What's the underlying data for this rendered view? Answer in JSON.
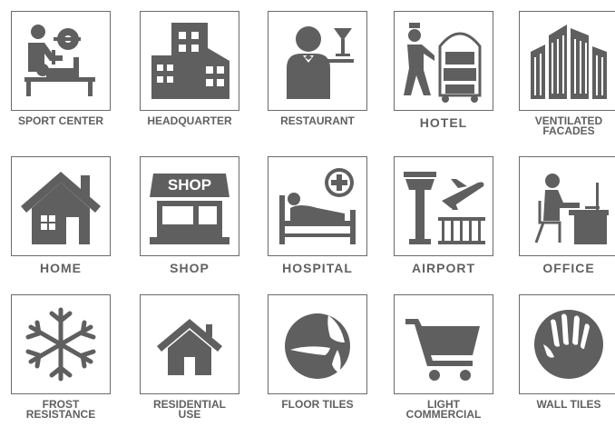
{
  "icons": [
    {
      "label": "SPORT CENTER",
      "icon": "weightlifting-icon"
    },
    {
      "label": "HEADQUARTER",
      "icon": "buildings-icon"
    },
    {
      "label": "RESTAURANT",
      "icon": "waiter-icon"
    },
    {
      "label": "HOTEL",
      "icon": "bellhop-luggage-cart-icon"
    },
    {
      "label": "VENTILATED\nFACADES",
      "icon": "skyscrapers-icon"
    },
    {
      "label": "HOME",
      "icon": "house-icon"
    },
    {
      "label": "SHOP",
      "icon": "shop-icon",
      "sign_text": "SHOP"
    },
    {
      "label": "HOSPITAL",
      "icon": "hospital-bed-icon"
    },
    {
      "label": "AIRPORT",
      "icon": "airport-tower-icon"
    },
    {
      "label": "OFFICE",
      "icon": "office-desk-icon"
    },
    {
      "label": "FROST\nRESISTANCE",
      "icon": "snowflake-icon"
    },
    {
      "label": "RESIDENTIAL\nUSE",
      "icon": "small-house-icon"
    },
    {
      "label": "FLOOR TILES",
      "icon": "floor-tiles-icon"
    },
    {
      "label": "LIGHT\nCOMMERCIAL",
      "icon": "shopping-cart-icon"
    },
    {
      "label": "WALL TILES",
      "icon": "hand-icon"
    }
  ],
  "colors": {
    "icon": "#5f5f5f",
    "label": "#606060",
    "border": "#6b6b6b"
  }
}
